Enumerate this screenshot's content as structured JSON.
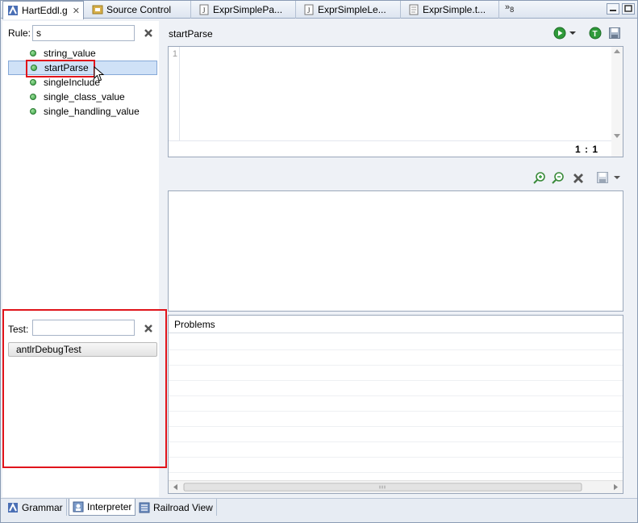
{
  "tabs": [
    {
      "label": "HartEddl.g",
      "icon": "grammar-file-icon",
      "active": true,
      "closable": true
    },
    {
      "label": "Source Control",
      "icon": "source-control-icon",
      "active": false
    },
    {
      "label": "ExprSimplePa...",
      "icon": "java-file-icon",
      "active": false
    },
    {
      "label": "ExprSimpleLe...",
      "icon": "java-file-icon",
      "active": false
    },
    {
      "label": "ExprSimple.t...",
      "icon": "text-file-icon",
      "active": false
    }
  ],
  "tab_overflow": {
    "symbol": "»",
    "count": "8"
  },
  "rules_panel": {
    "label": "Rule:",
    "filter_value": "s",
    "items": [
      {
        "label": "string_value",
        "selected": false
      },
      {
        "label": "startParse",
        "selected": true
      },
      {
        "label": "singleInclude",
        "selected": false
      },
      {
        "label": "single_class_value",
        "selected": false
      },
      {
        "label": "single_handling_value",
        "selected": false
      }
    ]
  },
  "test_panel": {
    "label": "Test:",
    "value": "",
    "items": [
      {
        "label": "antlrDebugTest"
      }
    ]
  },
  "editor": {
    "title": "startParse",
    "line_number": "1",
    "cursor_position": "1 : 1"
  },
  "problems": {
    "header": "Problems"
  },
  "bottom_tabs": [
    {
      "label": "Grammar",
      "icon": "grammar-icon",
      "active": false
    },
    {
      "label": "Interpreter",
      "icon": "interpreter-icon",
      "active": true
    },
    {
      "label": "Railroad View",
      "icon": "railroad-icon",
      "active": false
    }
  ],
  "colors": {
    "highlight": "#e0141b",
    "selection": "#cfe1f7",
    "run": "#2f9a3a"
  }
}
